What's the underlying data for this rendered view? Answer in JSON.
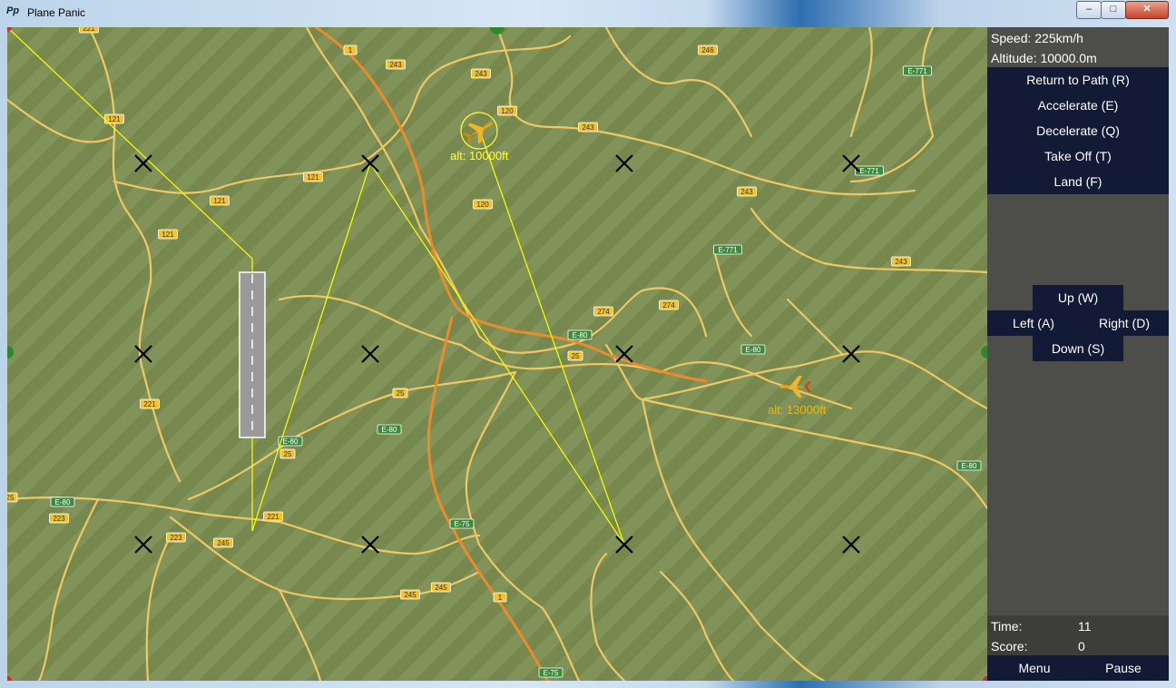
{
  "window": {
    "title": "Plane Panic",
    "icon_text": "Pp",
    "min_glyph": "–",
    "max_glyph": "□",
    "close_glyph": "✕"
  },
  "map": {
    "colors": {
      "terrain": "#7d8f52",
      "road": "#e8c25a",
      "highway": "#e88a2a",
      "path": "#ffff00",
      "waypoint": "#000000",
      "selected_label": "#ffff33",
      "other_label": "#f5b400"
    },
    "road_labels": [
      "221",
      "1",
      "243",
      "243",
      "246",
      "E-771",
      "120",
      "243",
      "121",
      "121",
      "121",
      "121",
      "120",
      "243",
      "E-771",
      "243",
      "274",
      "274",
      "E-80",
      "25",
      "E-80",
      "25",
      "221",
      "E-80",
      "E-80",
      "25",
      "221",
      "E-75",
      "223",
      "245",
      "223",
      "245",
      "245",
      "1",
      "E-75",
      "E-80",
      "E-771",
      "E-80",
      "25"
    ],
    "planes": [
      {
        "name": "selected",
        "alt_label": "alt: 10000ft",
        "icon": "plane-icon"
      },
      {
        "name": "other",
        "alt_label": "alt: 13000ft",
        "icon": "plane-icon"
      }
    ]
  },
  "panel": {
    "speed": "Speed: 225km/h",
    "altitude": "Altitude: 10000.0m",
    "commands": [
      "Return to Path (R)",
      "Accelerate (E)",
      "Decelerate (Q)",
      "Take Off (T)",
      "Land (F)"
    ],
    "directions": {
      "up": "Up (W)",
      "left": "Left (A)",
      "right": "Right (D)",
      "down": "Down (S)"
    },
    "time_label": "Time:",
    "time_value": "11",
    "score_label": "Score:",
    "score_value": "0",
    "menu": "Menu",
    "pause": "Pause",
    "colors": {
      "panel_bg": "#4d4d4a",
      "button_bg": "#121a35"
    }
  }
}
